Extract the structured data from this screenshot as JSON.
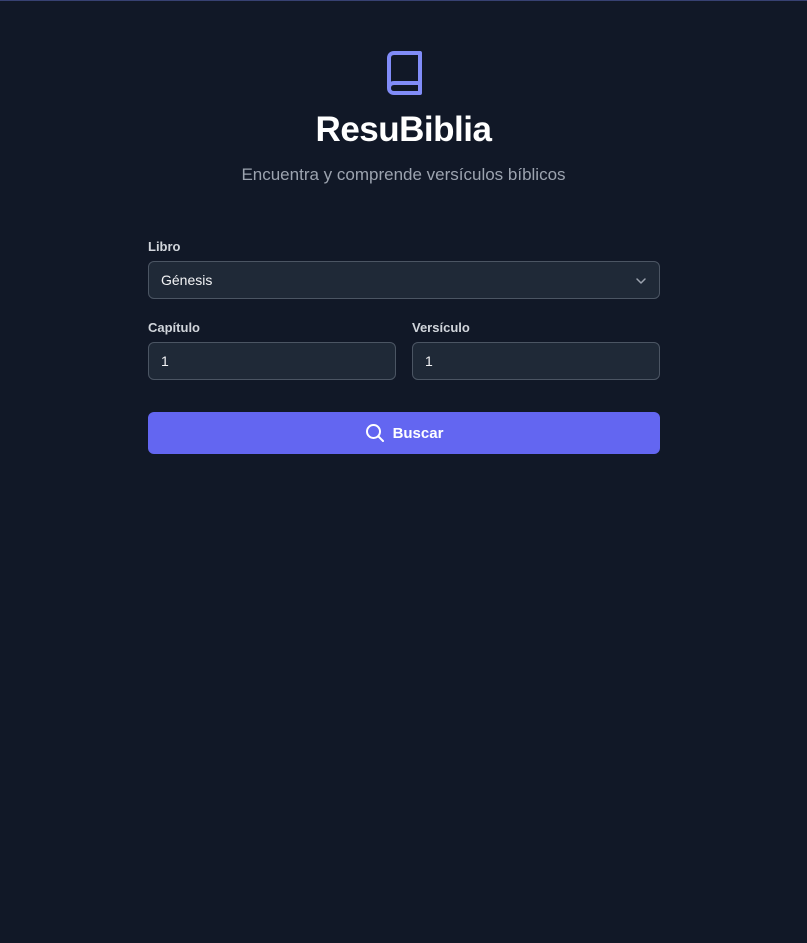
{
  "app": {
    "title": "ResuBiblia",
    "subtitle": "Encuentra y comprende versículos bíblicos",
    "logo_icon": "book-icon",
    "accent_color": "#6366f1",
    "background_color": "#111827"
  },
  "form": {
    "book": {
      "label": "Libro",
      "selected": "Génesis",
      "icon": "chevron-down-icon"
    },
    "chapter": {
      "label": "Capítulo",
      "value": "1"
    },
    "verse": {
      "label": "Versículo",
      "value": "1"
    },
    "submit": {
      "label": "Buscar",
      "icon": "search-icon"
    }
  }
}
